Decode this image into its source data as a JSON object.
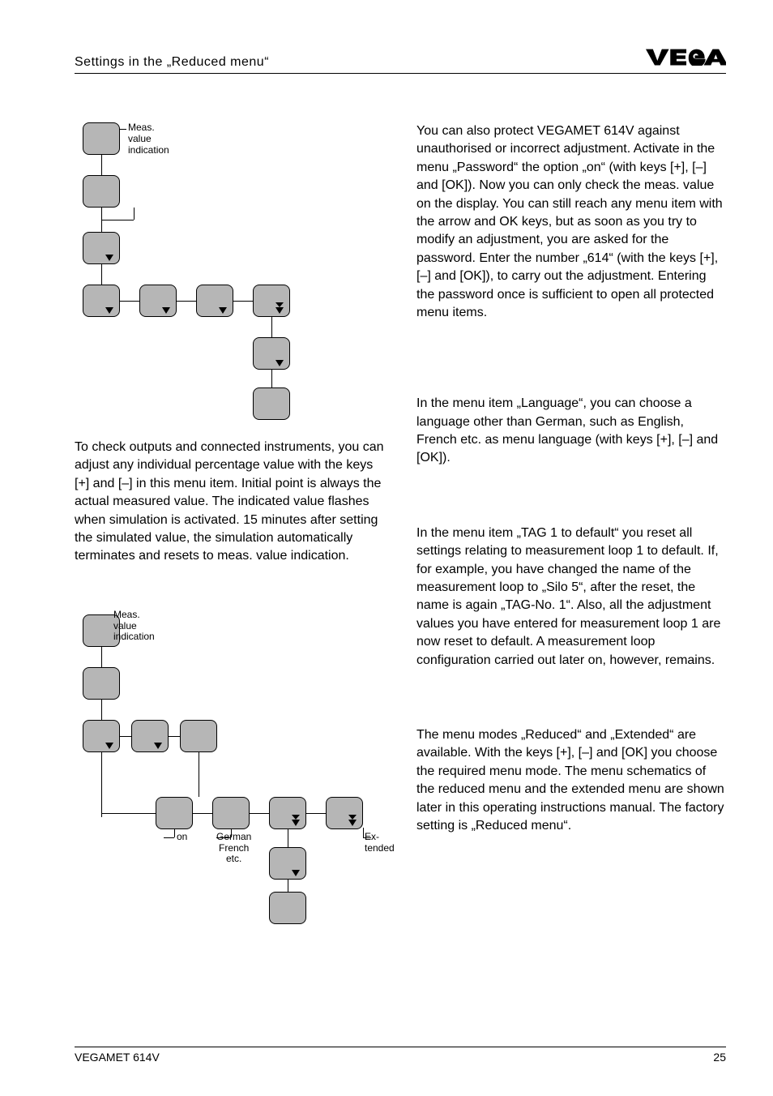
{
  "header": {
    "title": "Settings in the „Reduced menu“",
    "logo_alt": "VEGA"
  },
  "left": {
    "diagram1": {
      "label": "Meas.\nvalue\nindication"
    },
    "para1": "To check outputs and connected instruments, you can adjust any individual percentage value with the keys [+] and [–] in this menu item. Initial point is always the actual measured value. The indicated value flashes when simulation is activated. 15 minutes after setting the simulated value, the simulation automatically terminates and resets to meas. value indication.",
    "diagram2": {
      "label": "Meas.\nvalue\nindication",
      "on": "on",
      "lang": "German\nFrench\netc.",
      "ext": "Ex-\ntended"
    }
  },
  "right": {
    "para1": "You can also protect VEGAMET 614V against unauthorised or incorrect adjustment. Activate in the menu „Password“ the option „on“ (with keys [+], [–] and [OK]). Now you can only check the meas. value on the display. You can still reach any menu item with the arrow and OK keys, but as soon as you try to modify an adjustment, you are asked for the password. Enter the number „614“ (with the keys [+], [–] and [OK]), to carry out the adjustment. Entering the password once is sufficient to open all protected menu items.",
    "para2": "In the menu item „Language“, you can choose a language other than German, such as English, French etc. as menu language (with keys [+], [–] and [OK]).",
    "para3": "In the menu item „TAG 1 to default“ you reset all settings relating to measurement loop 1 to default. If, for example, you have changed the name of the measurement loop to „Silo 5“, after the reset, the name is again „TAG-No. 1“. Also, all the adjustment values you have entered for measurement loop 1 are now reset to default.  A measurement loop configuration carried out later on, however, remains.",
    "para4": "The menu modes „Reduced“ and „Extended“ are available. With the keys [+], [–] and [OK] you choose the required menu mode. The menu schematics of the reduced menu and the extended menu are shown later in this operating instructions manual. The factory setting is „Reduced menu“."
  },
  "footer": {
    "product": "VEGAMET 614V",
    "page": "25"
  }
}
